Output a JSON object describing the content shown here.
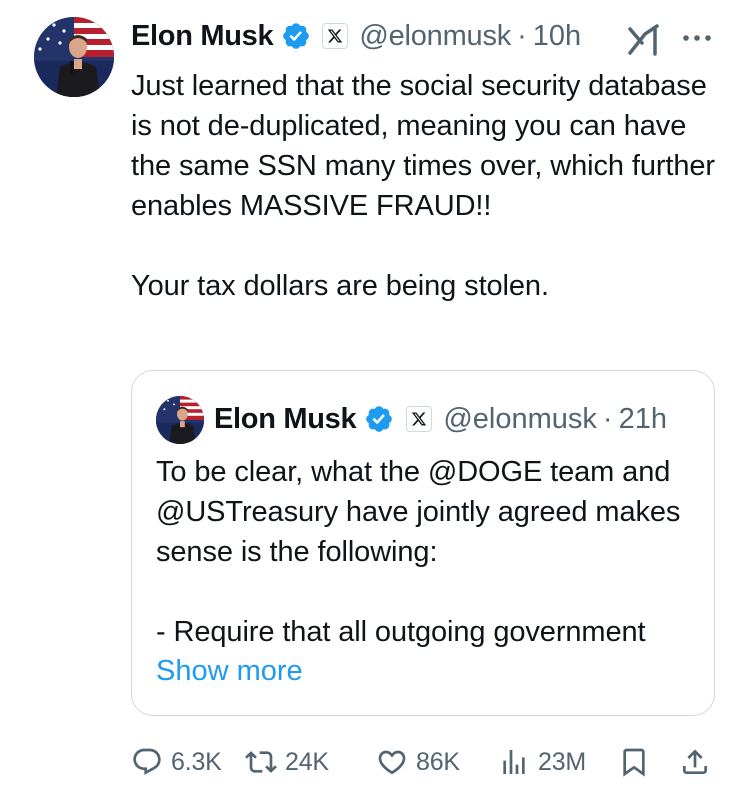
{
  "tweet": {
    "author_name": "Elon Musk",
    "x_badge_label": "X",
    "handle": "@elonmusk",
    "separator": "·",
    "time": "10h",
    "text": "Just learned that the social security database is not de-duplicated, meaning you can have the same SSN many times over, which further enables MASSIVE FRAUD!!\n\nYour tax dollars are being stolen.",
    "icons": {
      "verified": "verified-badge-icon",
      "grok": "grok-icon",
      "more": "more-options-icon"
    }
  },
  "quote": {
    "author_name": "Elon Musk",
    "x_badge_label": "X",
    "handle": "@elonmusk",
    "separator": "·",
    "time": "21h",
    "text": "To be clear, what the @DOGE team and @USTreasury have jointly agreed makes sense is the following:\n\n- Require that all outgoing government",
    "show_more_label": "Show more"
  },
  "actions": {
    "replies": "6.3K",
    "reposts": "24K",
    "likes": "86K",
    "views": "23M",
    "icons": [
      "reply-icon",
      "repost-icon",
      "like-icon",
      "views-icon",
      "bookmark-icon",
      "share-icon"
    ]
  },
  "colors": {
    "text_primary": "#0f1419",
    "text_secondary": "#536471",
    "link": "#1d9bf0",
    "verified": "#1d9bf0",
    "border": "#cfd9de"
  }
}
